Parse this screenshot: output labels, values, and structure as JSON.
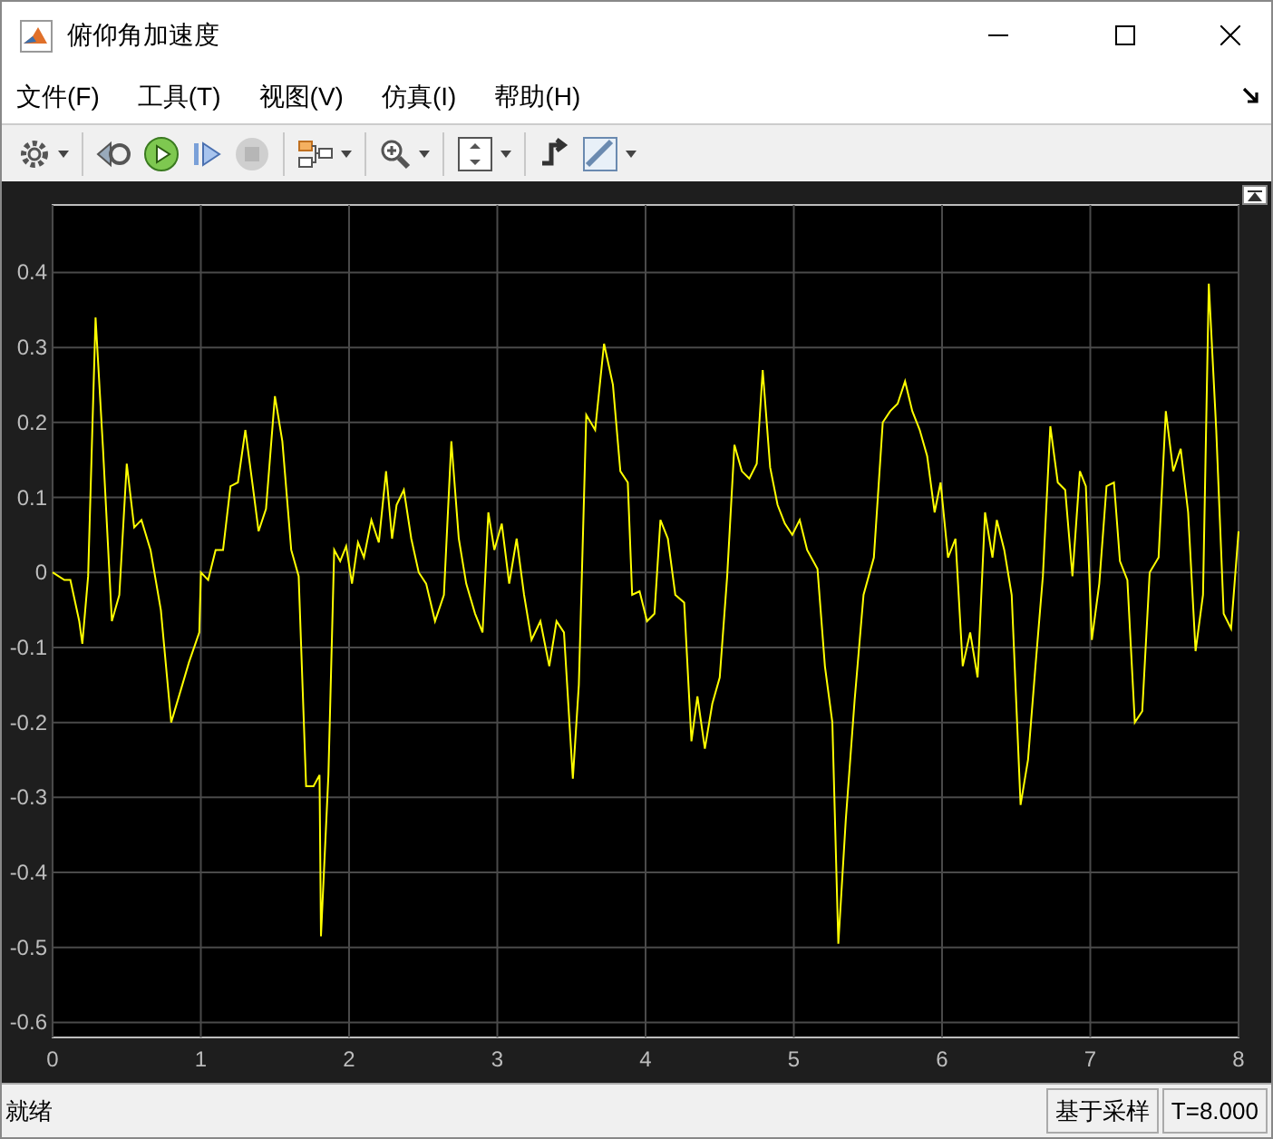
{
  "window": {
    "title": "俯仰角加速度"
  },
  "menu": [
    {
      "label": "文件(F)"
    },
    {
      "label": "工具(T)"
    },
    {
      "label": "视图(V)"
    },
    {
      "label": "仿真(I)"
    },
    {
      "label": "帮助(H)"
    }
  ],
  "toolbar": [
    {
      "kind": "settings",
      "dropdown": true,
      "disabled": false
    },
    {
      "kind": "step-back",
      "dropdown": false,
      "disabled": false
    },
    {
      "kind": "run",
      "dropdown": false,
      "disabled": false
    },
    {
      "kind": "step-forward",
      "dropdown": false,
      "disabled": false
    },
    {
      "kind": "stop",
      "dropdown": false,
      "disabled": true
    },
    {
      "kind": "signals",
      "dropdown": true,
      "disabled": false
    },
    {
      "kind": "zoom",
      "dropdown": true,
      "disabled": false
    },
    {
      "kind": "fit",
      "dropdown": true,
      "disabled": false
    },
    {
      "kind": "trigger",
      "dropdown": false,
      "disabled": false
    },
    {
      "kind": "measure",
      "dropdown": true,
      "disabled": false
    }
  ],
  "plot": {
    "chart_data": {
      "type": "line",
      "grid": true,
      "xlim": [
        0,
        8
      ],
      "ylim": [
        -0.62,
        0.49
      ],
      "xticks": [
        0,
        1,
        2,
        3,
        4,
        5,
        6,
        7,
        8
      ],
      "yticks": [
        -0.6,
        -0.5,
        -0.4,
        -0.3,
        -0.2,
        -0.1,
        0,
        0.1,
        0.2,
        0.3,
        0.4
      ],
      "x": [
        0,
        0.08,
        0.12,
        0.18,
        0.2,
        0.24,
        0.29,
        0.34,
        0.4,
        0.45,
        0.5,
        0.55,
        0.6,
        0.66,
        0.73,
        0.8,
        0.86,
        0.92,
        0.99,
        1.0,
        1.05,
        1.1,
        1.15,
        1.2,
        1.25,
        1.3,
        1.35,
        1.39,
        1.44,
        1.5,
        1.55,
        1.61,
        1.66,
        1.71,
        1.76,
        1.8,
        1.81,
        1.86,
        1.9,
        1.94,
        1.98,
        2.02,
        2.06,
        2.1,
        2.15,
        2.2,
        2.25,
        2.29,
        2.32,
        2.37,
        2.42,
        2.47,
        2.52,
        2.58,
        2.64,
        2.69,
        2.74,
        2.79,
        2.85,
        2.9,
        2.94,
        2.98,
        3.03,
        3.08,
        3.13,
        3.18,
        3.23,
        3.29,
        3.35,
        3.4,
        3.45,
        3.51,
        3.55,
        3.6,
        3.66,
        3.72,
        3.78,
        3.83,
        3.88,
        3.91,
        3.96,
        4.01,
        4.06,
        4.1,
        4.15,
        4.2,
        4.26,
        4.31,
        4.35,
        4.4,
        4.45,
        4.5,
        4.55,
        4.6,
        4.65,
        4.7,
        4.75,
        4.79,
        4.84,
        4.89,
        4.94,
        4.99,
        5.04,
        5.09,
        5.16,
        5.21,
        5.26,
        5.3,
        5.35,
        5.41,
        5.47,
        5.54,
        5.6,
        5.65,
        5.7,
        5.75,
        5.8,
        5.85,
        5.9,
        5.95,
        5.99,
        6.04,
        6.09,
        6.14,
        6.19,
        6.24,
        6.29,
        6.34,
        6.37,
        6.42,
        6.47,
        6.53,
        6.58,
        6.63,
        6.68,
        6.73,
        6.78,
        6.83,
        6.88,
        6.93,
        6.97,
        7.01,
        7.06,
        7.11,
        7.16,
        7.2,
        7.25,
        7.3,
        7.35,
        7.4,
        7.46,
        7.51,
        7.56,
        7.61,
        7.66,
        7.71,
        7.76,
        7.8,
        7.85,
        7.9,
        7.95,
        8.0
      ],
      "series": [
        {
          "color": "#ffff00",
          "values": [
            0,
            -0.01,
            -0.01,
            -0.065,
            -0.095,
            -0.005,
            0.34,
            0.165,
            -0.065,
            -0.03,
            0.145,
            0.06,
            0.07,
            0.03,
            -0.05,
            -0.2,
            -0.16,
            -0.12,
            -0.08,
            0,
            -0.01,
            0.03,
            0.03,
            0.115,
            0.12,
            0.19,
            0.115,
            0.055,
            0.085,
            0.235,
            0.175,
            0.03,
            -0.005,
            -0.285,
            -0.285,
            -0.27,
            -0.485,
            -0.27,
            0.03,
            0.015,
            0.035,
            -0.015,
            0.04,
            0.02,
            0.07,
            0.04,
            0.135,
            0.045,
            0.09,
            0.11,
            0.045,
            0,
            -0.015,
            -0.065,
            -0.03,
            0.175,
            0.045,
            -0.015,
            -0.055,
            -0.08,
            0.08,
            0.03,
            0.065,
            -0.015,
            0.045,
            -0.03,
            -0.09,
            -0.065,
            -0.125,
            -0.065,
            -0.08,
            -0.275,
            -0.15,
            0.21,
            0.19,
            0.305,
            0.25,
            0.135,
            0.12,
            -0.03,
            -0.025,
            -0.065,
            -0.055,
            0.07,
            0.045,
            -0.03,
            -0.04,
            -0.225,
            -0.165,
            -0.235,
            -0.175,
            -0.14,
            -0.005,
            0.17,
            0.135,
            0.125,
            0.145,
            0.27,
            0.14,
            0.09,
            0.065,
            0.05,
            0.07,
            0.03,
            0.005,
            -0.125,
            -0.2,
            -0.495,
            -0.33,
            -0.17,
            -0.03,
            0.02,
            0.2,
            0.215,
            0.225,
            0.255,
            0.215,
            0.19,
            0.155,
            0.08,
            0.12,
            0.02,
            0.045,
            -0.125,
            -0.08,
            -0.14,
            0.08,
            0.02,
            0.07,
            0.03,
            -0.03,
            -0.31,
            -0.25,
            -0.125,
            -0.005,
            0.195,
            0.12,
            0.11,
            -0.005,
            0.135,
            0.115,
            -0.09,
            -0.015,
            0.115,
            0.12,
            0.015,
            -0.01,
            -0.2,
            -0.185,
            0,
            0.02,
            0.215,
            0.135,
            0.165,
            0.08,
            -0.105,
            -0.03,
            0.385,
            0.19,
            -0.055,
            -0.075,
            0.055
          ]
        }
      ]
    }
  },
  "status_bar": {
    "message": "就绪",
    "mode": "基于采样",
    "time": "T=8.000"
  }
}
